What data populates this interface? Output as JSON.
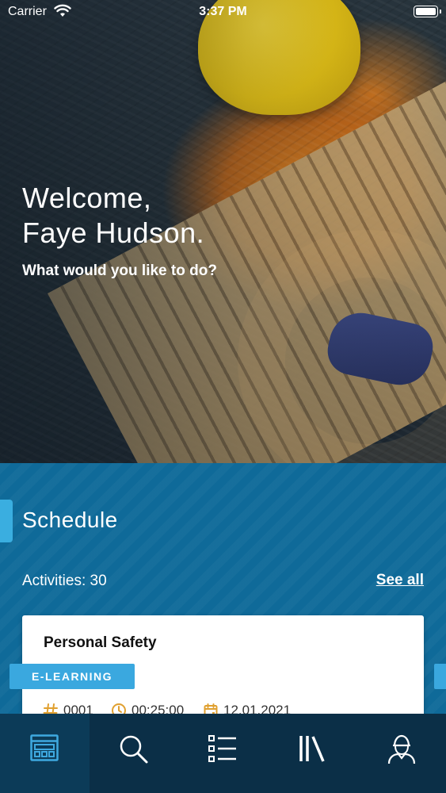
{
  "status_bar": {
    "carrier": "Carrier",
    "time": "3:37 PM"
  },
  "hero": {
    "welcome_line1": "Welcome,",
    "welcome_line2": "Faye Hudson.",
    "prompt": "What would you like to do?"
  },
  "schedule": {
    "title": "Schedule",
    "activities_label": "Activities: 30",
    "see_all": "See all",
    "card": {
      "title": "Personal Safety",
      "badge": "E-LEARNING",
      "id": "0001",
      "duration": "00:25:00",
      "date": "12.01.2021"
    }
  },
  "tab_bar": {
    "tabs": [
      {
        "icon": "dashboard-icon",
        "active": true
      },
      {
        "icon": "search-icon",
        "active": false
      },
      {
        "icon": "checklist-icon",
        "active": false
      },
      {
        "icon": "library-icon",
        "active": false
      },
      {
        "icon": "profile-icon",
        "active": false
      }
    ]
  },
  "colors": {
    "accent": "#3aa8df",
    "section_bg": "#0f6a99",
    "tabbar_bg": "#0b2f47",
    "meta_icon": "#e0a030"
  }
}
